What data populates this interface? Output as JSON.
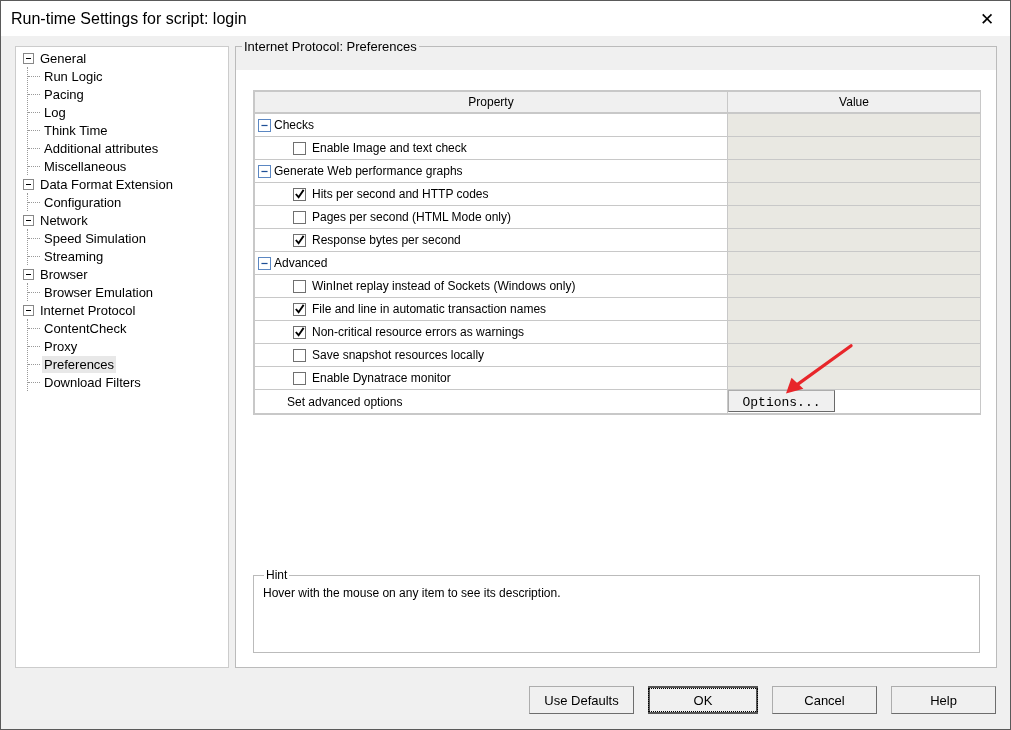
{
  "window": {
    "title": "Run-time Settings for script: login",
    "close_icon": "✕"
  },
  "tree": [
    {
      "label": "General",
      "expanded": true,
      "selected": false,
      "children": [
        {
          "label": "Run Logic",
          "selected": false
        },
        {
          "label": "Pacing",
          "selected": false
        },
        {
          "label": "Log",
          "selected": false
        },
        {
          "label": "Think Time",
          "selected": false
        },
        {
          "label": "Additional attributes",
          "selected": false
        },
        {
          "label": "Miscellaneous",
          "selected": false
        }
      ]
    },
    {
      "label": "Data Format Extension",
      "expanded": true,
      "selected": false,
      "children": [
        {
          "label": "Configuration",
          "selected": false
        }
      ]
    },
    {
      "label": "Network",
      "expanded": true,
      "selected": false,
      "children": [
        {
          "label": "Speed Simulation",
          "selected": false
        },
        {
          "label": "Streaming",
          "selected": false
        }
      ]
    },
    {
      "label": "Browser",
      "expanded": true,
      "selected": false,
      "children": [
        {
          "label": "Browser Emulation",
          "selected": false
        }
      ]
    },
    {
      "label": "Internet Protocol",
      "expanded": true,
      "selected": false,
      "children": [
        {
          "label": "ContentCheck",
          "selected": false
        },
        {
          "label": "Proxy",
          "selected": false
        },
        {
          "label": "Preferences",
          "selected": true
        },
        {
          "label": "Download Filters",
          "selected": false
        }
      ]
    }
  ],
  "group_title": "Internet Protocol: Preferences",
  "table": {
    "columns": [
      "Property",
      "Value"
    ],
    "rows": [
      {
        "kind": "group",
        "label": "Checks",
        "expanded": true
      },
      {
        "kind": "check",
        "label": "Enable Image and text check",
        "checked": false
      },
      {
        "kind": "group",
        "label": "Generate Web performance graphs",
        "expanded": true
      },
      {
        "kind": "check",
        "label": "Hits per second and HTTP codes",
        "checked": true
      },
      {
        "kind": "check",
        "label": "Pages per second (HTML Mode only)",
        "checked": false
      },
      {
        "kind": "check",
        "label": "Response bytes per second",
        "checked": true
      },
      {
        "kind": "group",
        "label": "Advanced",
        "expanded": true
      },
      {
        "kind": "check",
        "label": "WinInet replay instead of Sockets (Windows only)",
        "checked": false
      },
      {
        "kind": "check",
        "label": "File and line in automatic transaction names",
        "checked": true
      },
      {
        "kind": "check",
        "label": "Non-critical resource errors as warnings",
        "checked": true
      },
      {
        "kind": "check",
        "label": "Save snapshot resources locally",
        "checked": false
      },
      {
        "kind": "check",
        "label": "Enable Dynatrace monitor",
        "checked": false
      },
      {
        "kind": "action",
        "label": "Set advanced options",
        "button": "Options..."
      }
    ]
  },
  "hint": {
    "title": "Hint",
    "text": "Hover with the mouse on any item to see its description."
  },
  "buttons": [
    {
      "label": "Use Defaults",
      "focused": false
    },
    {
      "label": "OK",
      "focused": true
    },
    {
      "label": "Cancel",
      "focused": false
    },
    {
      "label": "Help",
      "focused": false
    }
  ]
}
